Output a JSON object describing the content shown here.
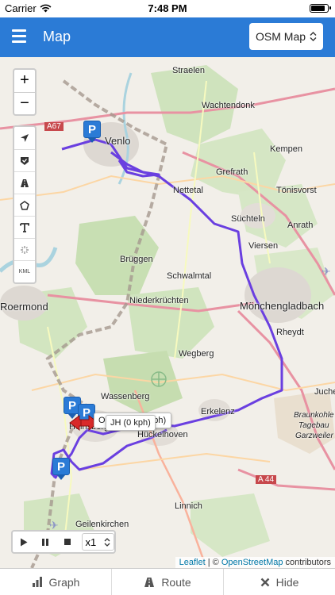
{
  "status": {
    "carrier": "Carrier",
    "time": "7:48 PM",
    "battery_level": 0.9
  },
  "navbar": {
    "title": "Map",
    "map_type": "OSM Map"
  },
  "map": {
    "labels": [
      {
        "id": "straelen",
        "text": "Straelen"
      },
      {
        "id": "wachtendonk",
        "text": "Wachtendonk"
      },
      {
        "id": "a67",
        "text": "A67"
      },
      {
        "id": "venlo",
        "text": "Venlo"
      },
      {
        "id": "kempen",
        "text": "Kempen"
      },
      {
        "id": "grefrath",
        "text": "Grefrath"
      },
      {
        "id": "nettetal",
        "text": "Nettetal"
      },
      {
        "id": "tonisvorst",
        "text": "Tönisvorst"
      },
      {
        "id": "suchteln",
        "text": "Süchteln"
      },
      {
        "id": "anrath",
        "text": "Anrath"
      },
      {
        "id": "viersen",
        "text": "Viersen"
      },
      {
        "id": "bruggen",
        "text": "Brüggen"
      },
      {
        "id": "schwalmtal",
        "text": "Schwalmtal"
      },
      {
        "id": "roermond",
        "text": "Roermond"
      },
      {
        "id": "niederkruchten",
        "text": "Niederkrüchten"
      },
      {
        "id": "monchengladbach",
        "text": "Mönchengladbach"
      },
      {
        "id": "rheydt",
        "text": "Rheydt"
      },
      {
        "id": "wegberg",
        "text": "Wegberg"
      },
      {
        "id": "wassenberg",
        "text": "Wassenberg"
      },
      {
        "id": "juche",
        "text": "Juche"
      },
      {
        "id": "erkelenz",
        "text": "Erkelenz"
      },
      {
        "id": "heinsberg",
        "text": "Heinsberg"
      },
      {
        "id": "huckelhoven",
        "text": "Hückelhoven"
      },
      {
        "id": "braunkohle",
        "text": "Braunkohle"
      },
      {
        "id": "tagebau",
        "text": "Tagebau"
      },
      {
        "id": "garzweiler",
        "text": "Garzweiler"
      },
      {
        "id": "a44",
        "text": "A 44"
      },
      {
        "id": "linnich",
        "text": "Linnich"
      },
      {
        "id": "geilenkirchen",
        "text": "Geilenkirchen"
      }
    ],
    "zoom_in": "+",
    "zoom_out": "−",
    "kml_label": "KML",
    "marker_letter": "P",
    "tooltip_jh": "JH (0 kph)",
    "tooltip_behind_left": "OI",
    "tooltip_behind_right": "kph)",
    "route_color": "#6a3fe0",
    "playback": {
      "speed": "x1"
    },
    "attribution": {
      "leaflet": "Leaflet",
      "sep": " | © ",
      "osm": "OpenStreetMap",
      "suffix": " contributors"
    }
  },
  "tabbar": {
    "graph": "Graph",
    "route": "Route",
    "hide": "Hide"
  }
}
